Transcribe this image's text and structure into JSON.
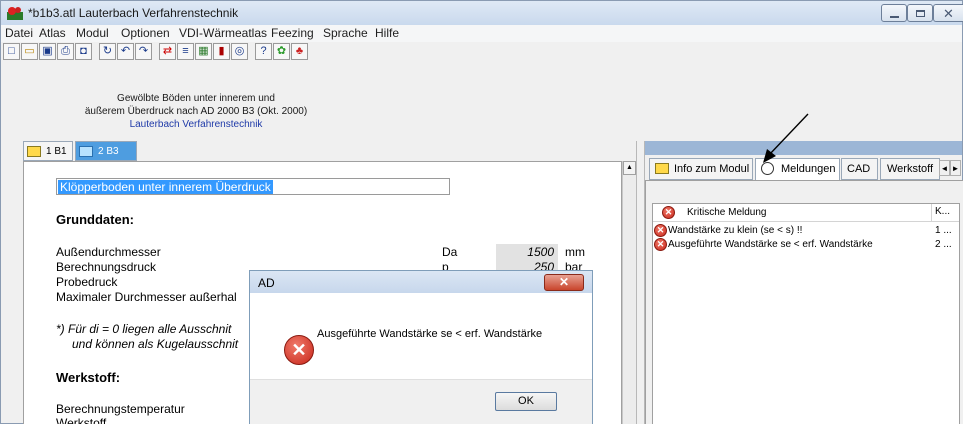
{
  "window": {
    "title": "*b1b3.atl   Lauterbach Verfahrenstechnik",
    "min_label": "",
    "max_label": "",
    "close_label": "✕"
  },
  "menu": [
    "Datei",
    "Atlas",
    "Modul",
    "Optionen",
    "VDI-Wärmeatlas",
    "Feezing",
    "Sprache",
    "Hilfe"
  ],
  "toolbar_icons": [
    "new-file-icon",
    "open-folder-icon",
    "save-icon",
    "print-icon",
    "preview-icon",
    "recalc-icon",
    "undo-icon",
    "redo-icon",
    "exchange-icon",
    "table-icon",
    "calculator-icon",
    "book-icon",
    "globe-icon",
    "help-pointer-icon",
    "bulb-icon",
    "app-logo-icon"
  ],
  "header": {
    "line1": "Gewölbte Böden unter innerem  und",
    "line2": "äußerem Überdruck nach AD 2000 B3 (Okt. 2000)",
    "line3": "Lauterbach Verfahrenstechnik"
  },
  "left_tabs": [
    {
      "label": "1 B1"
    },
    {
      "label": "2 B3"
    }
  ],
  "form": {
    "selection": "Klöpperboden unter innerem Überdruck",
    "section1": "Grunddaten:",
    "rows": [
      {
        "label": "Außendurchmesser",
        "symbol": "Da",
        "value": "1500",
        "unit": "mm"
      },
      {
        "label": "Berechnungsdruck",
        "symbol": "p",
        "value": "250",
        "unit": "bar"
      },
      {
        "label": "Probedruck"
      },
      {
        "label": "Maximaler Durchmesser außerhal"
      }
    ],
    "note1": "*)  Für di = 0 liegen alle Ausschnit",
    "note2": "und können als Kugelausschnit",
    "section2": "Werkstoff:",
    "row5": "Berechnungstemperatur",
    "row6": "Werkstoff"
  },
  "dialog": {
    "title": "AD",
    "close": "✕",
    "icon": "✕",
    "message": "Ausgeführte Wandstärke se < erf. Wandstärke",
    "ok": "OK"
  },
  "right_tabs": [
    {
      "label": "Info zum Modul"
    },
    {
      "label": "Meldungen"
    },
    {
      "label": "CAD"
    },
    {
      "label": "Werkstoff"
    }
  ],
  "tab_scroll": {
    "left": "◄",
    "right": "►"
  },
  "messages": {
    "header_col1": "Kritische Meldung",
    "header_col2": "K...",
    "rows": [
      {
        "text": "Wandstärke zu klein (se < s) !!",
        "num": "1 ..."
      },
      {
        "text": "Ausgeführte Wandstärke se < erf. Wandstärke",
        "num": "2 ..."
      }
    ]
  },
  "colors": {
    "selection": "#3399ff",
    "active_tab": "#4e9de0",
    "error": "#c8261a"
  }
}
